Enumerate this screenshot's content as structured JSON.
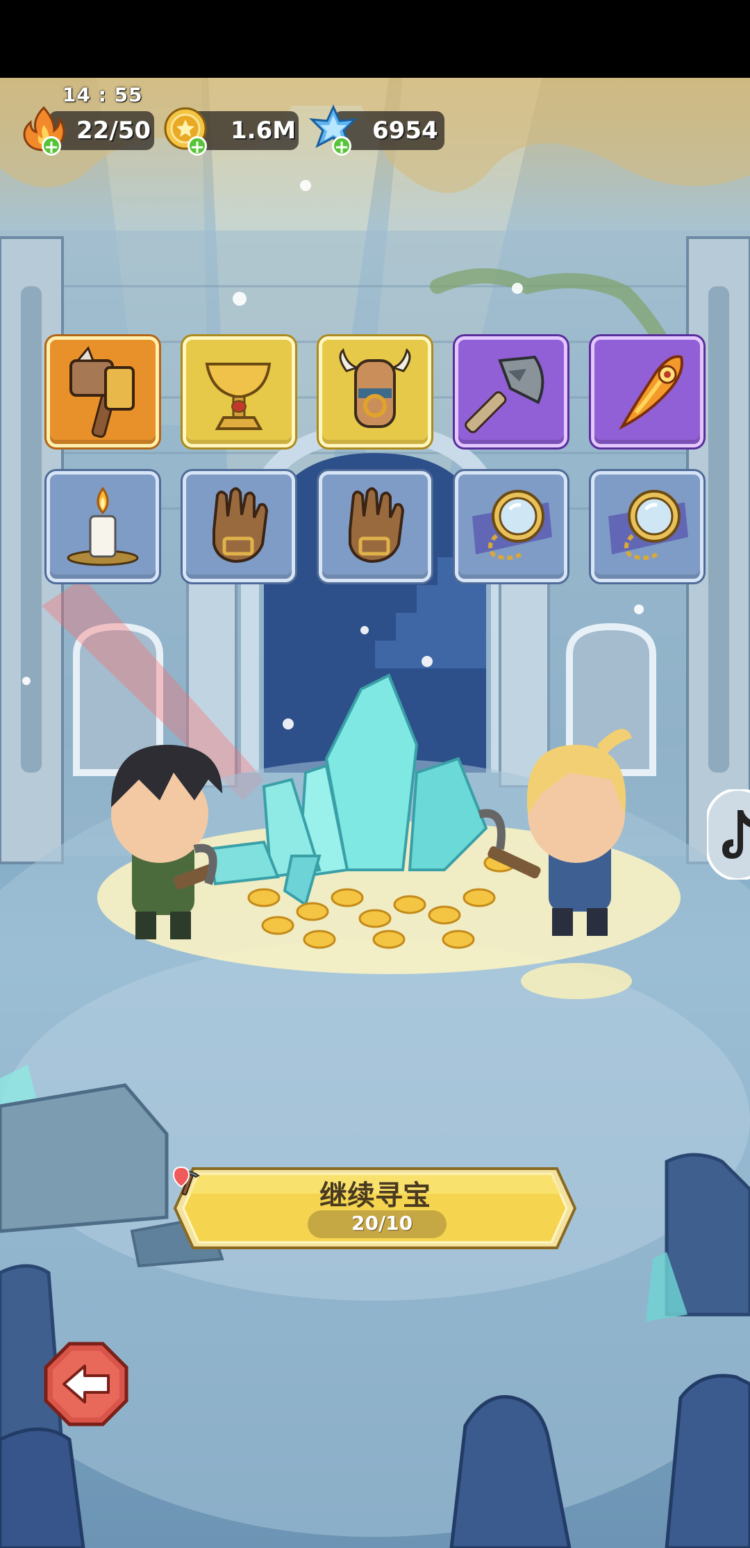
{
  "status_bar": {
    "time": "14 : 55"
  },
  "resources": {
    "energy": {
      "icon": "flame-icon",
      "value": "22/50"
    },
    "coins": {
      "icon": "gold-coin-icon",
      "value": "1.6M"
    },
    "crystals": {
      "icon": "blue-crystal-icon",
      "value": "6954"
    }
  },
  "items": [
    {
      "icon": "war-hammer-icon",
      "rarity": "orange"
    },
    {
      "icon": "golden-chalice-icon",
      "rarity": "gold"
    },
    {
      "icon": "horned-totem-icon",
      "rarity": "gold"
    },
    {
      "icon": "stone-axe-icon",
      "rarity": "purple"
    },
    {
      "icon": "phoenix-feather-icon",
      "rarity": "purple"
    },
    {
      "icon": "candle-icon",
      "rarity": "blue"
    },
    {
      "icon": "leather-glove-icon",
      "rarity": "blue"
    },
    {
      "icon": "leather-glove-icon",
      "rarity": "blue"
    },
    {
      "icon": "magnifying-glass-icon",
      "rarity": "blue"
    },
    {
      "icon": "magnifying-glass-icon",
      "rarity": "blue"
    }
  ],
  "continue_button": {
    "label": "继续寻宝",
    "count": "20/10",
    "icon": "pickaxe-icon"
  },
  "colors": {
    "orange": "#e8912a",
    "gold": "#e7c94a",
    "purple": "#9260d6",
    "blue": "#7f9cc7",
    "button": "#f5d550"
  }
}
